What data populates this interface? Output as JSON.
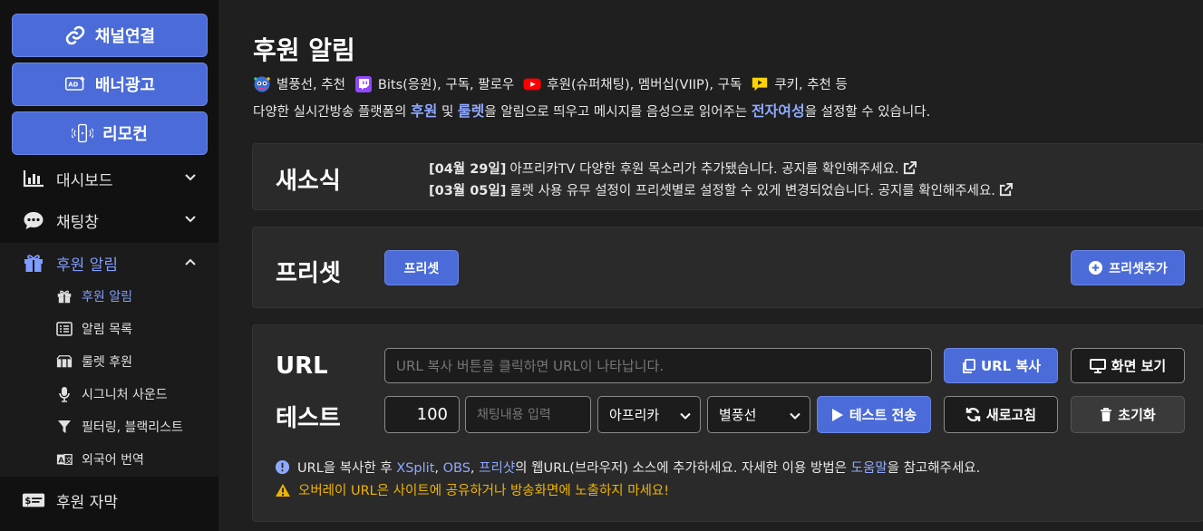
{
  "sidebar": {
    "buttons": [
      {
        "label": "채널연결",
        "icon": "link-icon"
      },
      {
        "label": "배너광고",
        "icon": "ad-icon"
      },
      {
        "label": "리모컨",
        "icon": "remote-icon"
      }
    ],
    "menu": {
      "dashboard": "대시보드",
      "chat": "채팅창",
      "donation_alert": "후원 알림",
      "donation_caption": "후원 자막"
    },
    "submenu": [
      "후원 알림",
      "알림 목록",
      "룰렛 후원",
      "시그니처 사운드",
      "필터링, 블랙리스트",
      "외국어 번역"
    ]
  },
  "main": {
    "title": "후원 알림",
    "desc_line1": {
      "p1": "별풍선, 추천",
      "p2": "Bits(응원), 구독, 팔로우",
      "p3": "후원(슈퍼채팅), 멤버십(VIIP), 구독",
      "p4": "쿠키, 추천 등"
    },
    "desc_line2": {
      "a": "다양한 실시간방송 플랫폼의 ",
      "b": "후원",
      "c": " 및 ",
      "d": "룰렛",
      "e": "을 알림으로 띄우고 메시지를 음성으로 읽어주는 ",
      "f": "전자여성",
      "g": "을 설정할 수 있습니다."
    },
    "news": {
      "label": "새소식",
      "items": [
        {
          "date": "[04월 29일]",
          "text": "아프리카TV 다양한 후원 목소리가 추가됐습니다. 공지를 확인해주세요."
        },
        {
          "date": "[03월 05일]",
          "text": "룰렛 사용 유무 설정이 프리셋별로 설정할 수 있게 변경되었습니다. 공지를 확인해주세요."
        }
      ]
    },
    "preset": {
      "label": "프리셋",
      "chip": "프리셋",
      "add_button": "프리셋추가"
    },
    "url": {
      "label": "URL",
      "placeholder": "URL 복사 버튼을 클릭하면 URL이 나타납니다.",
      "copy_button": "URL 복사",
      "view_button": "화면 보기"
    },
    "test": {
      "label": "테스트",
      "amount": "100",
      "chat_placeholder": "채팅내용 입력",
      "platform": "아프리카",
      "type": "별풍선",
      "send_button": "테스트 전송",
      "refresh_button": "새로고침",
      "reset_button": "초기화"
    },
    "notes": {
      "info": {
        "a": "URL을 복사한 후 ",
        "l1": "XSplit",
        "b": ", ",
        "l2": "OBS",
        "c": ", ",
        "l3": "프리샷",
        "d": "의 웹URL(브라우저) 소스에 추가하세요. 자세한 이용 방법은 ",
        "l4": "도움말",
        "e": "을 참고해주세요."
      },
      "warning": "오버레이 URL은 사이트에 공유하거나 방송화면에 노출하지 마세요!"
    }
  },
  "colors": {
    "accent": "#4a6bd8",
    "link": "#8fa9ff",
    "warning": "#f0b400",
    "warning_text": "#f0b400",
    "info": "#8fa9ff"
  }
}
